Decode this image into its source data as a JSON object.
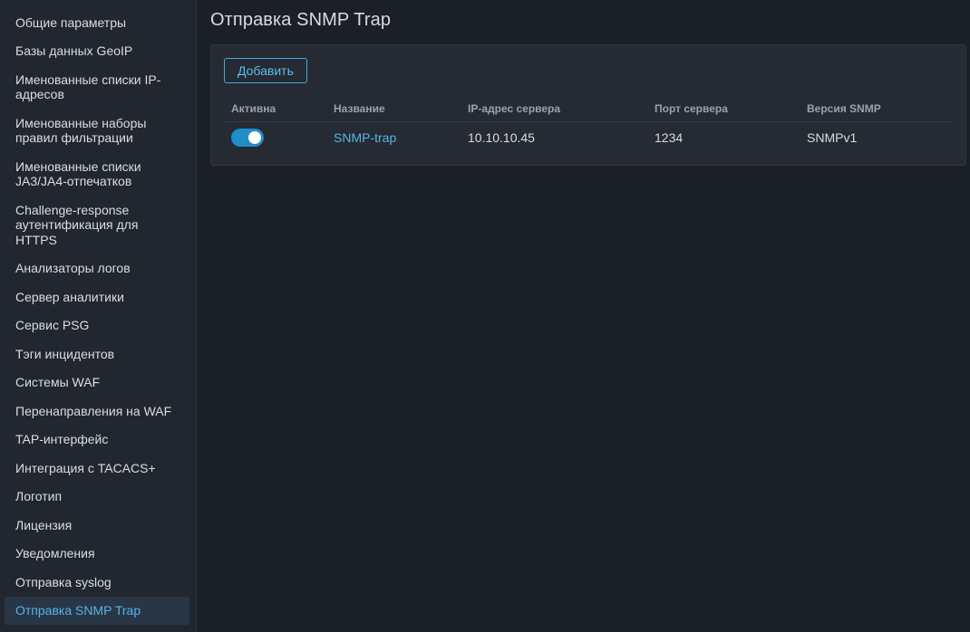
{
  "sidebar": {
    "items": [
      {
        "label": "Общие параметры"
      },
      {
        "label": "Базы данных GeoIP"
      },
      {
        "label": "Именованные списки IP-адресов"
      },
      {
        "label": "Именованные наборы правил фильтрации"
      },
      {
        "label": "Именованные списки JA3/JA4-отпечатков"
      },
      {
        "label": "Challenge-response аутентификация для HTTPS"
      },
      {
        "label": "Анализаторы логов"
      },
      {
        "label": "Сервер аналитики"
      },
      {
        "label": "Сервис PSG"
      },
      {
        "label": "Тэги инцидентов"
      },
      {
        "label": "Системы WAF"
      },
      {
        "label": "Перенаправления на WAF"
      },
      {
        "label": "TAP-интерфейс"
      },
      {
        "label": "Интеграция с TACACS+"
      },
      {
        "label": "Логотип"
      },
      {
        "label": "Лицензия"
      },
      {
        "label": "Уведомления"
      },
      {
        "label": "Отправка syslog"
      },
      {
        "label": "Отправка SNMP Trap"
      }
    ],
    "active_index": 18
  },
  "main": {
    "title": "Отправка SNMP Trap",
    "add_label": "Добавить",
    "table": {
      "headers": {
        "active": "Активна",
        "name": "Название",
        "ip": "IP-адрес сервера",
        "port": "Порт сервера",
        "version": "Версия SNMP"
      },
      "rows": [
        {
          "active": true,
          "name": "SNMP-trap",
          "ip": "10.10.10.45",
          "port": "1234",
          "version": "SNMPv1"
        }
      ]
    }
  },
  "colors": {
    "accent": "#56b4e6",
    "toggle_on": "#1e8fc9",
    "background": "#1b1f26",
    "sidebar_bg": "#22272f",
    "panel_bg": "#252a33"
  }
}
